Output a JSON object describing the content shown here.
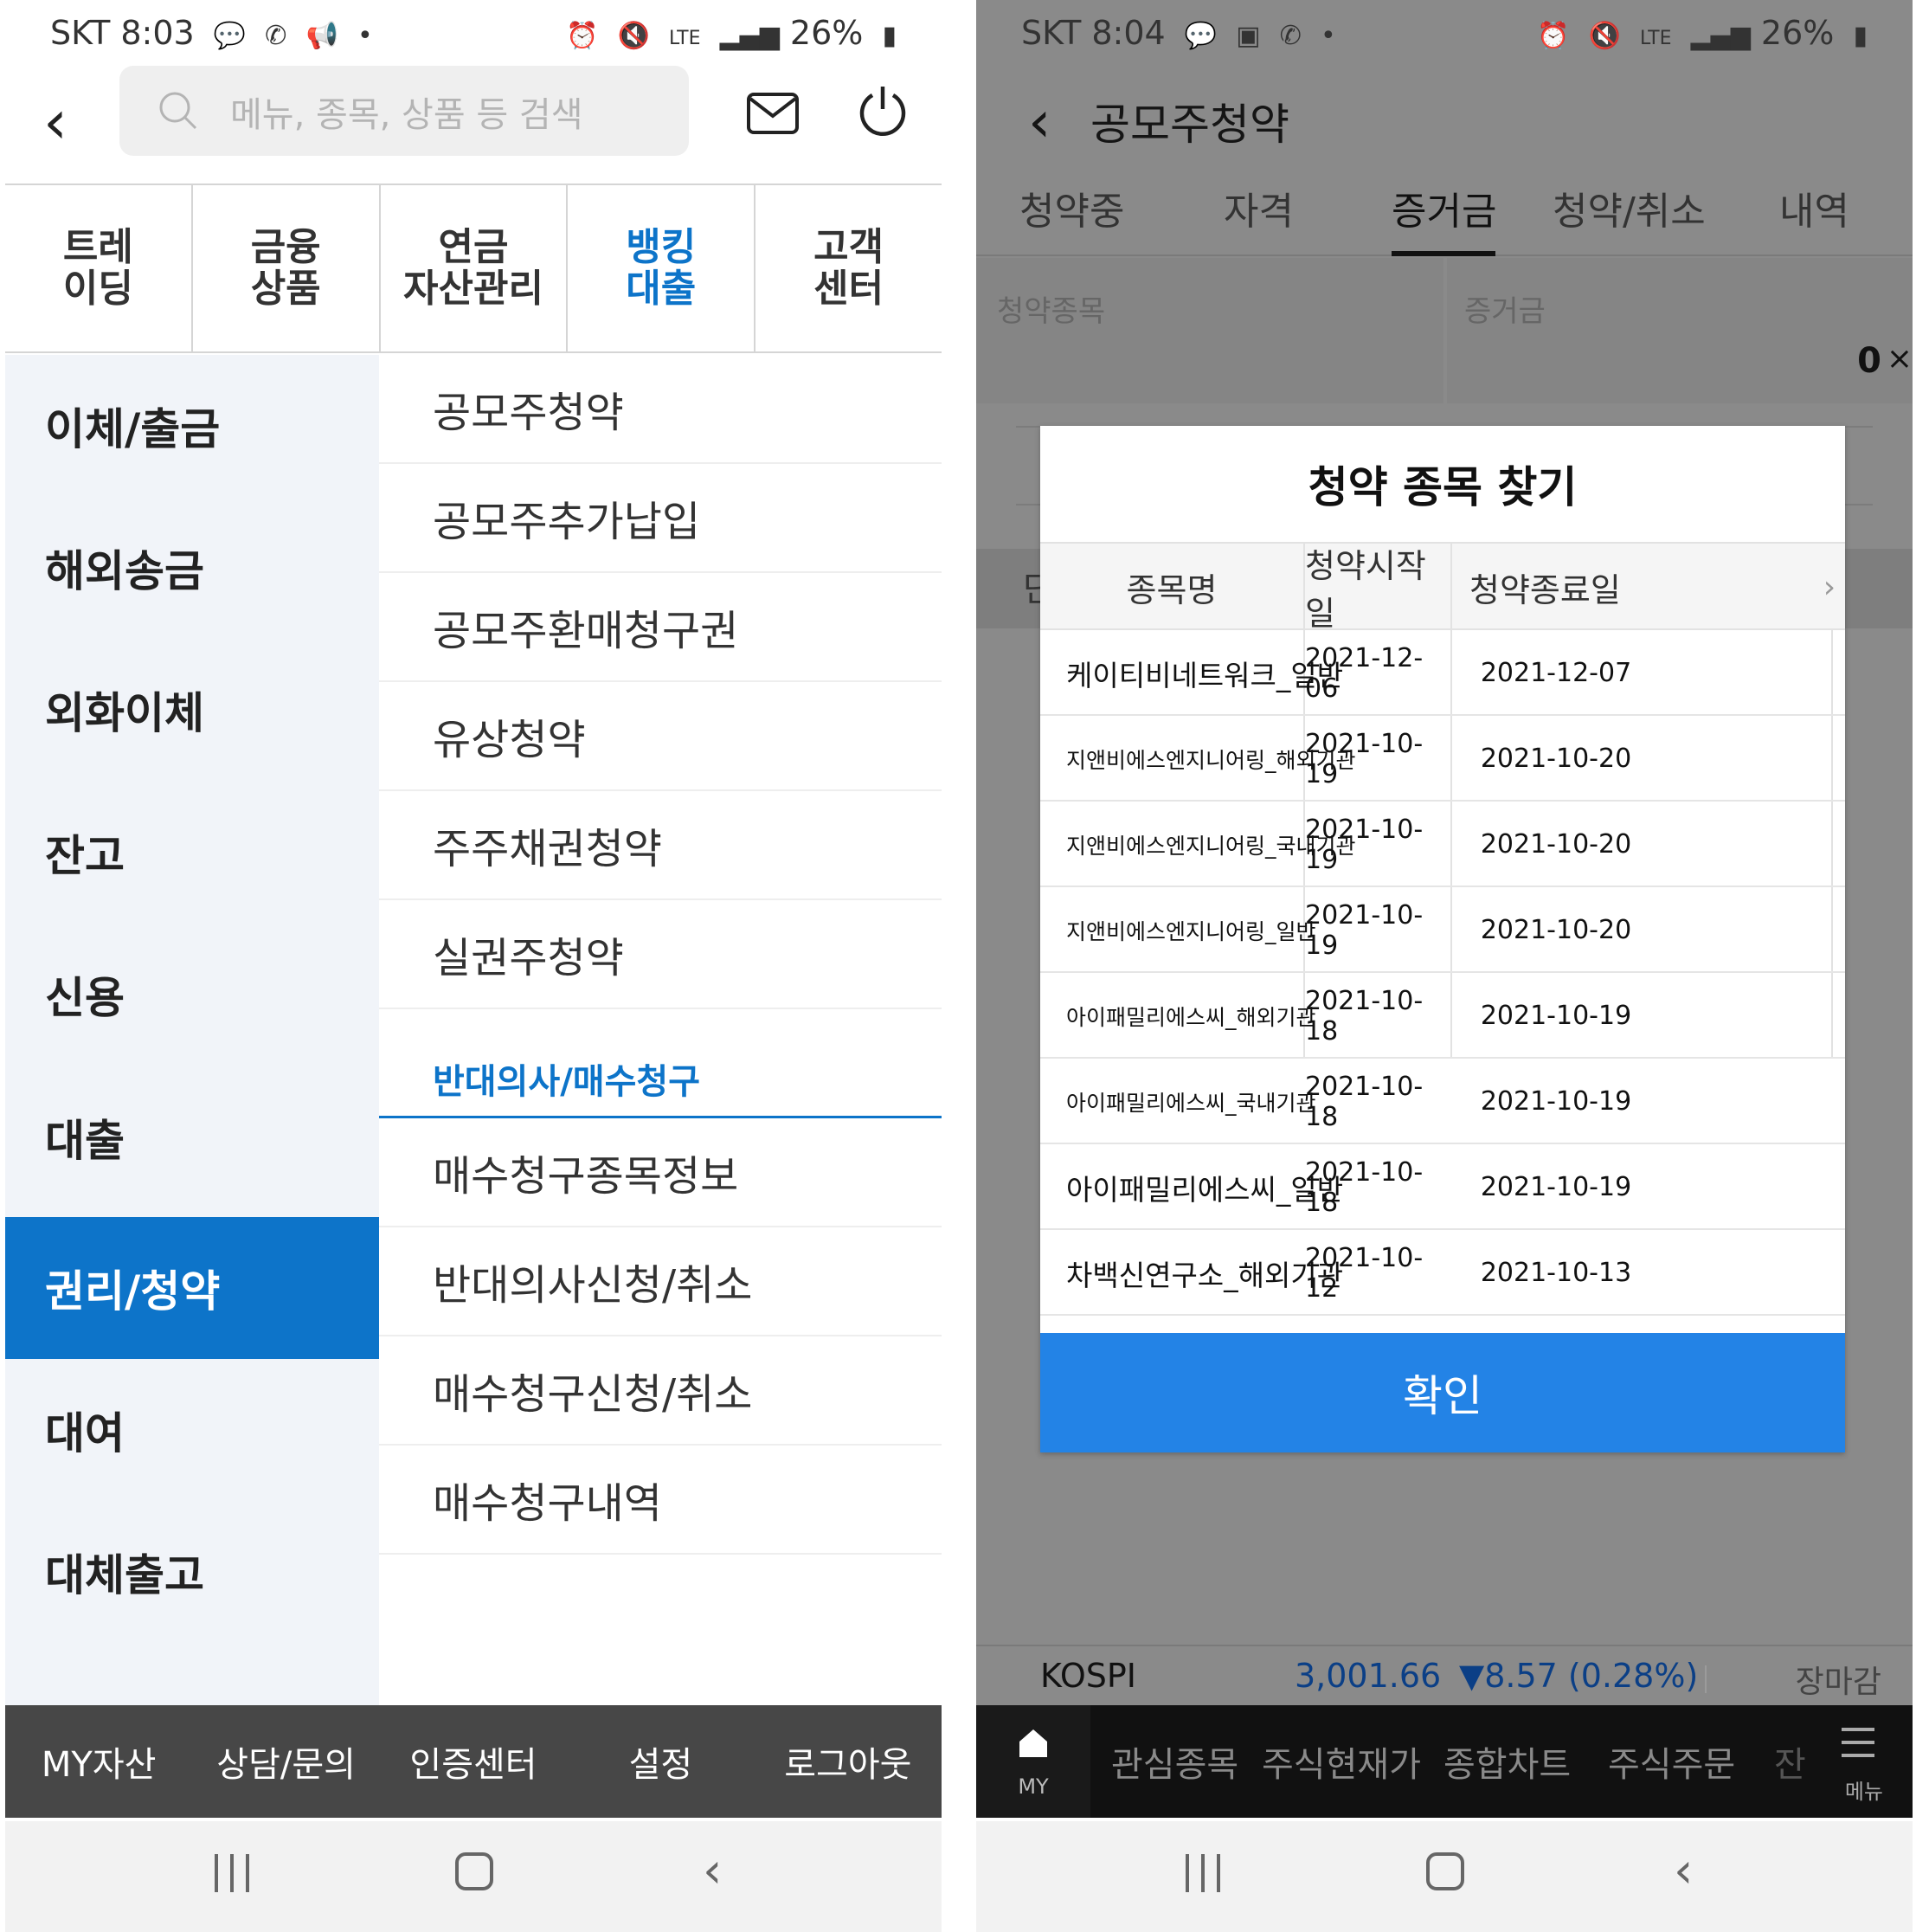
{
  "left": {
    "status": {
      "time": "SKT 8:03",
      "battery": "26%",
      "icons": [
        "talk-icon",
        "vowifi-icon",
        "megaphone-icon",
        "alarm-icon",
        "mute-icon",
        "lte-icon",
        "signal-icon",
        "battery-icon"
      ]
    },
    "search": {
      "placeholder": "메뉴, 종목, 상품 등 검색"
    },
    "top_nav": [
      {
        "line1": "트레",
        "line2": "이딩"
      },
      {
        "line1": "금융",
        "line2": "상품"
      },
      {
        "line1": "연금",
        "line2": "자산관리"
      },
      {
        "line1": "뱅킹",
        "line2": "대출"
      },
      {
        "line1": "고객",
        "line2": "센터"
      }
    ],
    "side_menu": [
      "이체/출금",
      "해외송금",
      "외화이체",
      "잔고",
      "신용",
      "대출",
      "권리/청약",
      "대여",
      "대체출고"
    ],
    "sub_menu": {
      "items": [
        "공모주청약",
        "공모주추가납입",
        "공모주환매청구권",
        "유상청약",
        "주주채권청약",
        "실권주청약"
      ],
      "section_header": "반대의사/매수청구",
      "section_items": [
        "매수청구종목정보",
        "반대의사신청/취소",
        "매수청구신청/취소",
        "매수청구내역"
      ]
    },
    "footer": [
      "MY자산",
      "상담/문의",
      "인증센터",
      "설정",
      "로그아웃"
    ]
  },
  "right": {
    "status": {
      "time": "SKT 8:04",
      "battery": "26%"
    },
    "title": "공모주청약",
    "tabs": [
      "청약중",
      "자격",
      "증거금",
      "청약/취소",
      "내역"
    ],
    "form": {
      "label1": "청약종목",
      "label2": "증거금",
      "value": "0",
      "close": "×"
    },
    "ghost_char": "단",
    "modal": {
      "title": "청약 종목 찾기",
      "columns": [
        "종목명",
        "청약시작일",
        "청약종료일"
      ],
      "rows": [
        {
          "name": "케이티비네트워크_일반",
          "start": "2021-12-06",
          "end": "2021-12-07"
        },
        {
          "name": "지앤비에스엔지니어링_해외기관",
          "start": "2021-10-19",
          "end": "2021-10-20"
        },
        {
          "name": "지앤비에스엔지니어링_국내기관",
          "start": "2021-10-19",
          "end": "2021-10-20"
        },
        {
          "name": "지앤비에스엔지니어링_일반",
          "start": "2021-10-19",
          "end": "2021-10-20"
        },
        {
          "name": "아이패밀리에스씨_해외기관",
          "start": "2021-10-18",
          "end": "2021-10-19"
        },
        {
          "name": "아이패밀리에스씨_국내기관",
          "start": "2021-10-18",
          "end": "2021-10-19"
        },
        {
          "name": "아이패밀리에스씨_일반",
          "start": "2021-10-18",
          "end": "2021-10-19"
        },
        {
          "name": "차백신연구소_해외기관",
          "start": "2021-10-12",
          "end": "2021-10-13"
        }
      ],
      "confirm": "확인"
    },
    "kospi": {
      "label": "KOSPI",
      "value": "3,001.66",
      "change": "▼8.57 (0.28%)",
      "status": "장마감"
    },
    "footer": {
      "my": "MY",
      "items": [
        "관심종목",
        "주식현재가",
        "종합차트",
        "주식주문",
        "잔"
      ],
      "menu": "메뉴"
    }
  }
}
